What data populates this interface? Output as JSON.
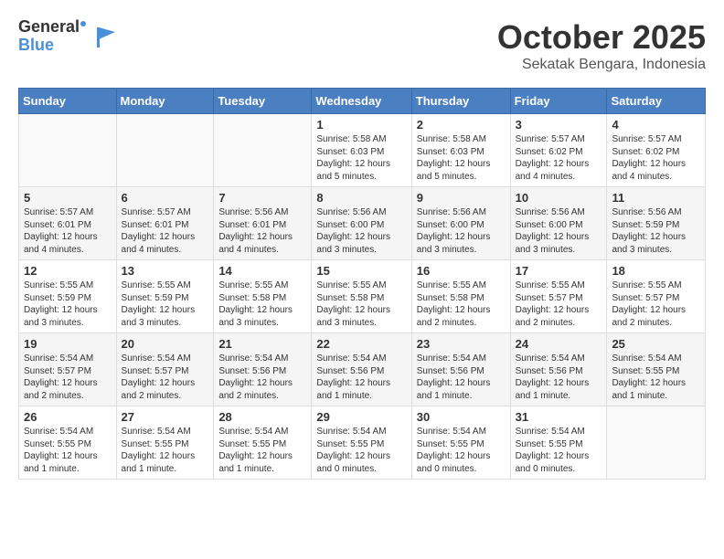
{
  "logo": {
    "general": "General",
    "blue": "Blue"
  },
  "header": {
    "title": "October 2025",
    "subtitle": "Sekatak Bengara, Indonesia"
  },
  "days_of_week": [
    "Sunday",
    "Monday",
    "Tuesday",
    "Wednesday",
    "Thursday",
    "Friday",
    "Saturday"
  ],
  "weeks": [
    [
      {
        "day": "",
        "info": ""
      },
      {
        "day": "",
        "info": ""
      },
      {
        "day": "",
        "info": ""
      },
      {
        "day": "1",
        "info": "Sunrise: 5:58 AM\nSunset: 6:03 PM\nDaylight: 12 hours\nand 5 minutes."
      },
      {
        "day": "2",
        "info": "Sunrise: 5:58 AM\nSunset: 6:03 PM\nDaylight: 12 hours\nand 5 minutes."
      },
      {
        "day": "3",
        "info": "Sunrise: 5:57 AM\nSunset: 6:02 PM\nDaylight: 12 hours\nand 4 minutes."
      },
      {
        "day": "4",
        "info": "Sunrise: 5:57 AM\nSunset: 6:02 PM\nDaylight: 12 hours\nand 4 minutes."
      }
    ],
    [
      {
        "day": "5",
        "info": "Sunrise: 5:57 AM\nSunset: 6:01 PM\nDaylight: 12 hours\nand 4 minutes."
      },
      {
        "day": "6",
        "info": "Sunrise: 5:57 AM\nSunset: 6:01 PM\nDaylight: 12 hours\nand 4 minutes."
      },
      {
        "day": "7",
        "info": "Sunrise: 5:56 AM\nSunset: 6:01 PM\nDaylight: 12 hours\nand 4 minutes."
      },
      {
        "day": "8",
        "info": "Sunrise: 5:56 AM\nSunset: 6:00 PM\nDaylight: 12 hours\nand 3 minutes."
      },
      {
        "day": "9",
        "info": "Sunrise: 5:56 AM\nSunset: 6:00 PM\nDaylight: 12 hours\nand 3 minutes."
      },
      {
        "day": "10",
        "info": "Sunrise: 5:56 AM\nSunset: 6:00 PM\nDaylight: 12 hours\nand 3 minutes."
      },
      {
        "day": "11",
        "info": "Sunrise: 5:56 AM\nSunset: 5:59 PM\nDaylight: 12 hours\nand 3 minutes."
      }
    ],
    [
      {
        "day": "12",
        "info": "Sunrise: 5:55 AM\nSunset: 5:59 PM\nDaylight: 12 hours\nand 3 minutes."
      },
      {
        "day": "13",
        "info": "Sunrise: 5:55 AM\nSunset: 5:59 PM\nDaylight: 12 hours\nand 3 minutes."
      },
      {
        "day": "14",
        "info": "Sunrise: 5:55 AM\nSunset: 5:58 PM\nDaylight: 12 hours\nand 3 minutes."
      },
      {
        "day": "15",
        "info": "Sunrise: 5:55 AM\nSunset: 5:58 PM\nDaylight: 12 hours\nand 3 minutes."
      },
      {
        "day": "16",
        "info": "Sunrise: 5:55 AM\nSunset: 5:58 PM\nDaylight: 12 hours\nand 2 minutes."
      },
      {
        "day": "17",
        "info": "Sunrise: 5:55 AM\nSunset: 5:57 PM\nDaylight: 12 hours\nand 2 minutes."
      },
      {
        "day": "18",
        "info": "Sunrise: 5:55 AM\nSunset: 5:57 PM\nDaylight: 12 hours\nand 2 minutes."
      }
    ],
    [
      {
        "day": "19",
        "info": "Sunrise: 5:54 AM\nSunset: 5:57 PM\nDaylight: 12 hours\nand 2 minutes."
      },
      {
        "day": "20",
        "info": "Sunrise: 5:54 AM\nSunset: 5:57 PM\nDaylight: 12 hours\nand 2 minutes."
      },
      {
        "day": "21",
        "info": "Sunrise: 5:54 AM\nSunset: 5:56 PM\nDaylight: 12 hours\nand 2 minutes."
      },
      {
        "day": "22",
        "info": "Sunrise: 5:54 AM\nSunset: 5:56 PM\nDaylight: 12 hours\nand 1 minute."
      },
      {
        "day": "23",
        "info": "Sunrise: 5:54 AM\nSunset: 5:56 PM\nDaylight: 12 hours\nand 1 minute."
      },
      {
        "day": "24",
        "info": "Sunrise: 5:54 AM\nSunset: 5:56 PM\nDaylight: 12 hours\nand 1 minute."
      },
      {
        "day": "25",
        "info": "Sunrise: 5:54 AM\nSunset: 5:55 PM\nDaylight: 12 hours\nand 1 minute."
      }
    ],
    [
      {
        "day": "26",
        "info": "Sunrise: 5:54 AM\nSunset: 5:55 PM\nDaylight: 12 hours\nand 1 minute."
      },
      {
        "day": "27",
        "info": "Sunrise: 5:54 AM\nSunset: 5:55 PM\nDaylight: 12 hours\nand 1 minute."
      },
      {
        "day": "28",
        "info": "Sunrise: 5:54 AM\nSunset: 5:55 PM\nDaylight: 12 hours\nand 1 minute."
      },
      {
        "day": "29",
        "info": "Sunrise: 5:54 AM\nSunset: 5:55 PM\nDaylight: 12 hours\nand 0 minutes."
      },
      {
        "day": "30",
        "info": "Sunrise: 5:54 AM\nSunset: 5:55 PM\nDaylight: 12 hours\nand 0 minutes."
      },
      {
        "day": "31",
        "info": "Sunrise: 5:54 AM\nSunset: 5:55 PM\nDaylight: 12 hours\nand 0 minutes."
      },
      {
        "day": "",
        "info": ""
      }
    ]
  ]
}
